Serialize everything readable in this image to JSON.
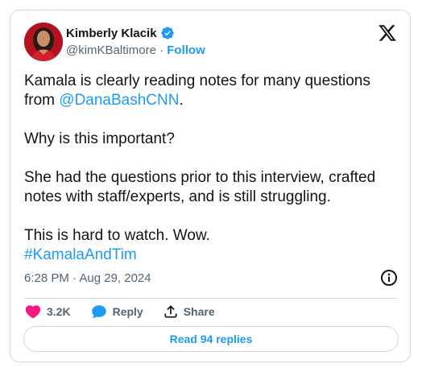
{
  "author": {
    "name": "Kimberly Klacik",
    "handle": "@kimKBaltimore",
    "separator": "·",
    "follow_label": "Follow",
    "verified_icon": "verified-badge-icon",
    "avatar_color": "#b3121f"
  },
  "tweet": {
    "line1_text": "Kamala is clearly reading notes for many questions from ",
    "mention": "@DanaBashCNN",
    "line1_end": ".",
    "paragraph2": "Why is this important?",
    "paragraph3": "She had the questions prior to this interview, crafted notes with staff/experts, and is still struggling.",
    "paragraph4": "This is hard to watch. Wow.",
    "hashtag": "#KamalaAndTim"
  },
  "meta": {
    "timestamp": "6:28 PM · Aug 29, 2024"
  },
  "actions": {
    "like_count": "3.2K",
    "reply_label": "Reply",
    "share_label": "Share"
  },
  "read_replies_label": "Read 94 replies",
  "colors": {
    "accent": "#1d9bf0",
    "like": "#f91880",
    "text": "#0f1419",
    "muted": "#536471",
    "border": "#cfd9de"
  }
}
